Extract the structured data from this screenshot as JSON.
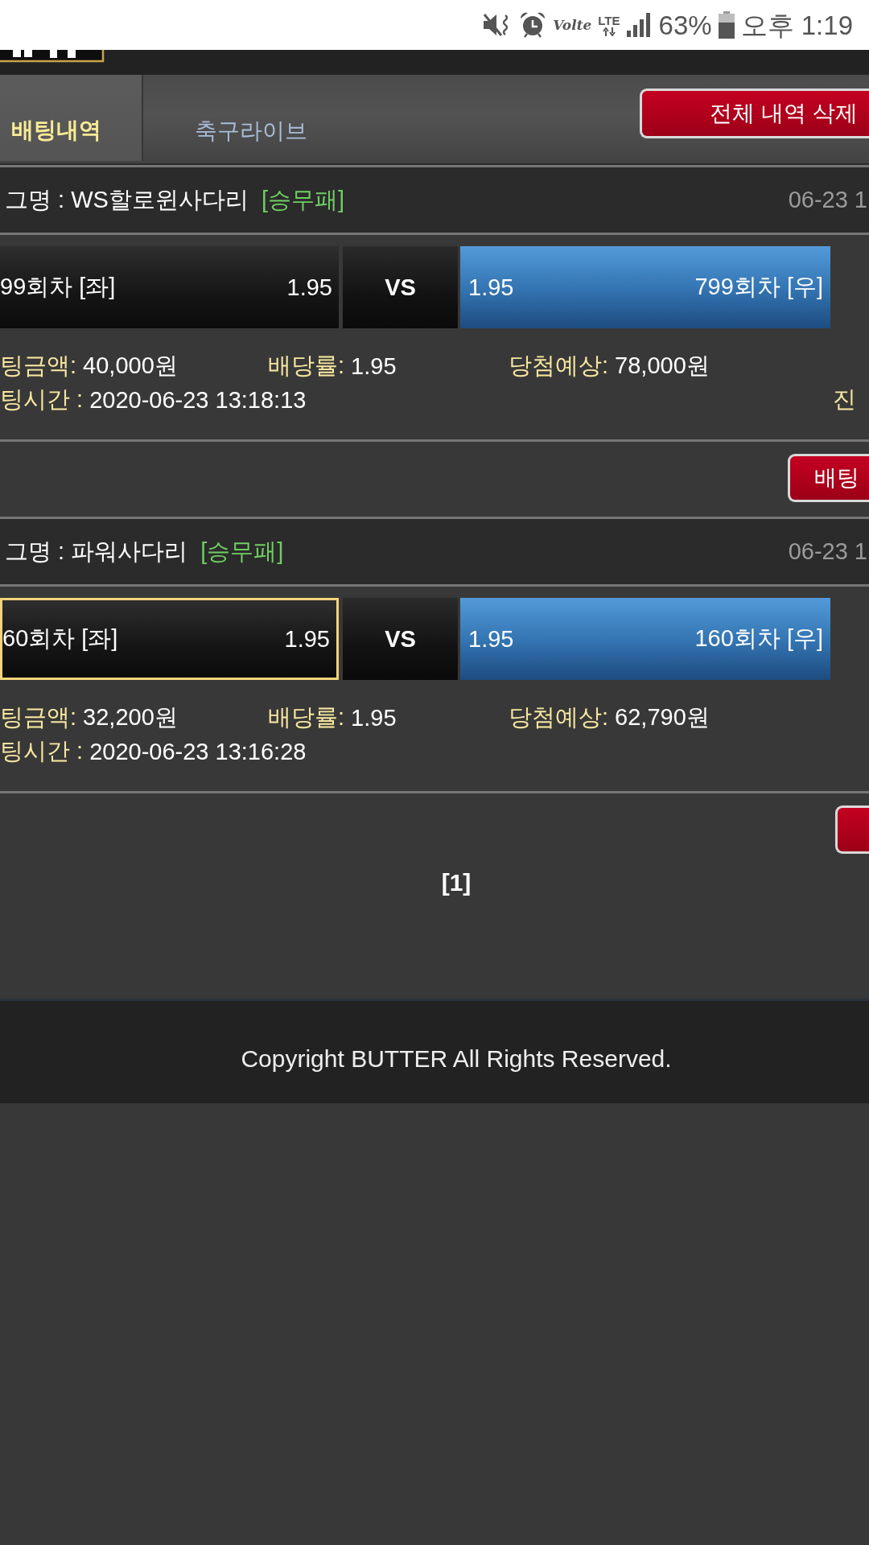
{
  "status_bar": {
    "volte": "Volte",
    "network": "LTE",
    "battery": "63%",
    "time": "오후 1:19"
  },
  "tabs": [
    {
      "label": "배팅내역",
      "selected": true
    },
    {
      "label": "축구라이브",
      "selected": false
    }
  ],
  "delete_all_button": "전체 내역 삭제",
  "bets": [
    {
      "league": "그명 : WS할로윈사다리",
      "bet_type": "[승무패]",
      "date": "06-23 1",
      "home": {
        "name": "99회차 [좌]",
        "odds": "1.95",
        "selected": false,
        "winner": false
      },
      "vs": "VS",
      "away": {
        "odds": "1.95",
        "name": "799회차 [우]",
        "selected": false,
        "winner": true
      },
      "details": [
        {
          "label": "팅금액:",
          "value": "40,000원"
        },
        {
          "label": "배당률:",
          "value": "1.95"
        },
        {
          "label": "당첨예상:",
          "value": "78,000원"
        }
      ],
      "time_label": "팅시간 :",
      "time": "2020-06-23 13:18:13",
      "status": "진",
      "action_button": {
        "shown": true,
        "label": "배팅"
      }
    },
    {
      "league": "그명 : 파워사다리",
      "bet_type": "[승무패]",
      "date": "06-23 1",
      "home": {
        "name": "60회차 [좌]",
        "odds": "1.95",
        "selected": true,
        "winner": false
      },
      "vs": "VS",
      "away": {
        "odds": "1.95",
        "name": "160회차 [우]",
        "selected": false,
        "winner": true
      },
      "details": [
        {
          "label": "팅금액:",
          "value": "32,200원"
        },
        {
          "label": "배당률:",
          "value": "1.95"
        },
        {
          "label": "당첨예상:",
          "value": "62,790원"
        }
      ],
      "time_label": "팅시간 :",
      "time": "2020-06-23 13:16:28",
      "action_button": {
        "shown": true
      }
    }
  ],
  "pagination": "[1]",
  "footer": "Copyright BUTTER All Rights Reserved."
}
